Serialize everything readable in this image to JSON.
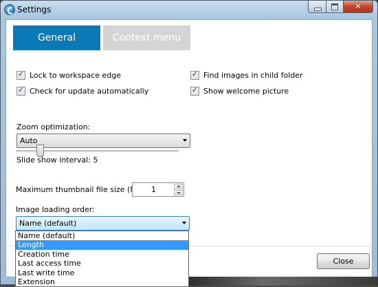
{
  "window": {
    "title": "Settings"
  },
  "tabs": [
    {
      "label": "General",
      "active": true
    },
    {
      "label": "Context menu",
      "active": false
    }
  ],
  "checkboxes": {
    "lock_to_workspace_edge": {
      "label": "Lock to workspace edge",
      "checked": true
    },
    "check_for_update": {
      "label": "Check for update automatically",
      "checked": true
    },
    "find_images_child": {
      "label": "Find images in child folder",
      "checked": true
    },
    "show_welcome_picture": {
      "label": "Show welcome picture",
      "checked": true
    }
  },
  "zoom": {
    "label": "Zoom optimization:",
    "value": "Auto"
  },
  "slideshow": {
    "label": "Slide show interval: 5",
    "value": 5
  },
  "thumbnail": {
    "label": "Maximum thumbnail file size (MB):",
    "value": "1"
  },
  "loading_order": {
    "label": "Image loading order:",
    "value": "Name (default)",
    "options": [
      "Name (default)",
      "Length",
      "Creation time",
      "Last access time",
      "Last write time",
      "Extension"
    ],
    "highlighted": "Length"
  },
  "footer": {
    "close_label": "Close"
  },
  "colors": {
    "accent": "#0b79b6",
    "highlight": "#3399ff",
    "inactive_tab": "#d4d4d4"
  },
  "icons": {
    "check": "✓",
    "close": "✕"
  }
}
